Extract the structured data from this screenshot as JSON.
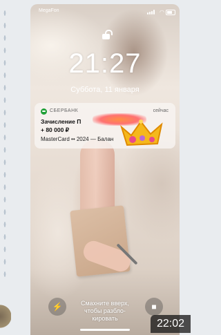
{
  "status_bar": {
    "carrier": "MegaFon",
    "wifi_icon": "wifi-icon",
    "battery_icon": "battery-icon"
  },
  "lock_screen": {
    "time": "21:27",
    "date": "Суббота, 11 января"
  },
  "notification": {
    "app": "СБЕРБАНК",
    "when": "сейчас",
    "title": "Зачисление П",
    "amount": "+ 80 000 ₽",
    "body": "MasterCard •• 2024 — Балан",
    "app_color": "#21a038"
  },
  "bottom": {
    "hint_line1": "Смахните вверх,",
    "hint_line2": "чтобы разбло-",
    "hint_line3": "кировать",
    "flashlight_icon": "flashlight-icon",
    "camera_icon": "camera-icon"
  },
  "overlay": {
    "clock": "22:02"
  }
}
